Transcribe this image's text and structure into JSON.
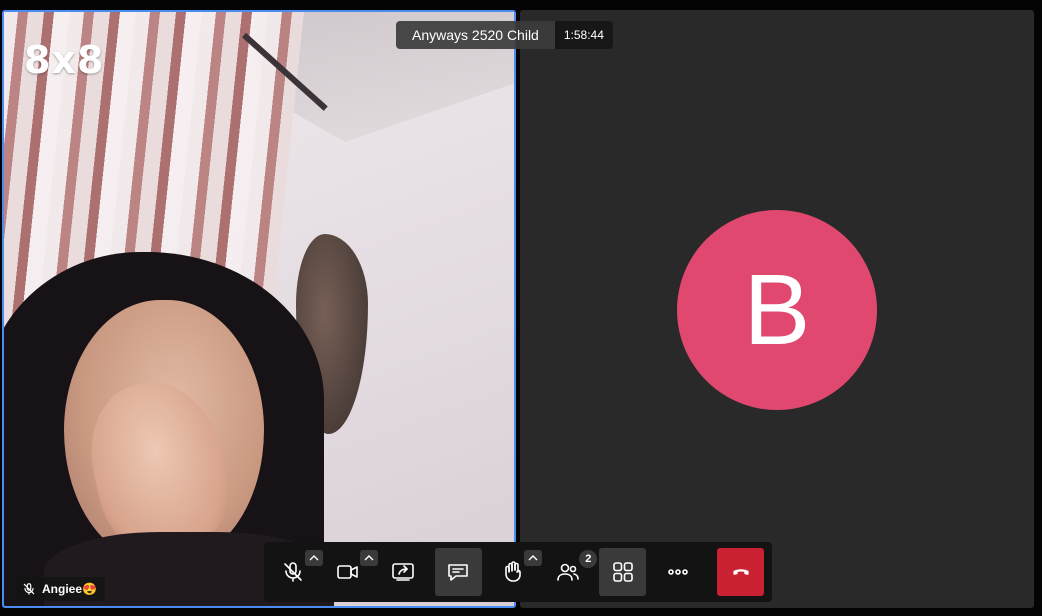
{
  "meeting": {
    "subject": "Anyways 2520 Child",
    "timer": "1:58:44"
  },
  "brand": {
    "logo_text": "8x8"
  },
  "local_participant": {
    "display_name": "Angiee😍",
    "muted": true,
    "active_speaker_border_color": "#4a8cf0"
  },
  "remote_participant": {
    "avatar_initial": "B",
    "avatar_color": "#e0486f"
  },
  "toolbar": {
    "items": [
      {
        "name": "microphone",
        "icon": "mic-off-icon",
        "has_options": true
      },
      {
        "name": "camera",
        "icon": "video-camera-icon",
        "has_options": true
      },
      {
        "name": "share-screen",
        "icon": "share-screen-icon"
      },
      {
        "name": "chat",
        "icon": "chat-icon",
        "active": true
      },
      {
        "name": "raise-hand",
        "icon": "raise-hand-icon",
        "has_options": true
      },
      {
        "name": "participants",
        "icon": "participants-icon",
        "badge": "2"
      },
      {
        "name": "tile-view",
        "icon": "tile-view-icon",
        "active": true
      },
      {
        "name": "more",
        "icon": "more-dots-icon"
      },
      {
        "name": "hangup",
        "icon": "hangup-phone-icon",
        "color": "#cb2233"
      }
    ]
  }
}
